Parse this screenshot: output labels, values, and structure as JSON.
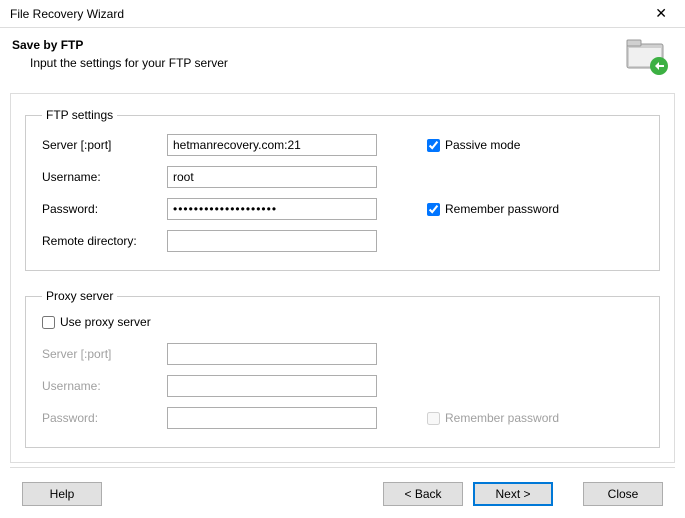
{
  "window": {
    "title": "File Recovery Wizard"
  },
  "header": {
    "title": "Save by FTP",
    "subtitle": "Input the settings for your FTP server"
  },
  "ftp": {
    "legend": "FTP settings",
    "server_label": "Server [:port]",
    "server_value": "hetmanrecovery.com:21",
    "username_label": "Username:",
    "username_value": "root",
    "password_label": "Password:",
    "password_value": "••••••••••••••••••••",
    "remote_label": "Remote directory:",
    "remote_value": "",
    "passive_label": "Passive mode",
    "passive_checked": true,
    "remember_label": "Remember password",
    "remember_checked": true
  },
  "proxy": {
    "legend": "Proxy server",
    "use_label": "Use proxy server",
    "use_checked": false,
    "server_label": "Server [:port]",
    "server_value": "",
    "username_label": "Username:",
    "username_value": "",
    "password_label": "Password:",
    "password_value": "",
    "remember_label": "Remember password",
    "remember_checked": false
  },
  "buttons": {
    "help": "Help",
    "back": "< Back",
    "next": "Next >",
    "close": "Close"
  }
}
